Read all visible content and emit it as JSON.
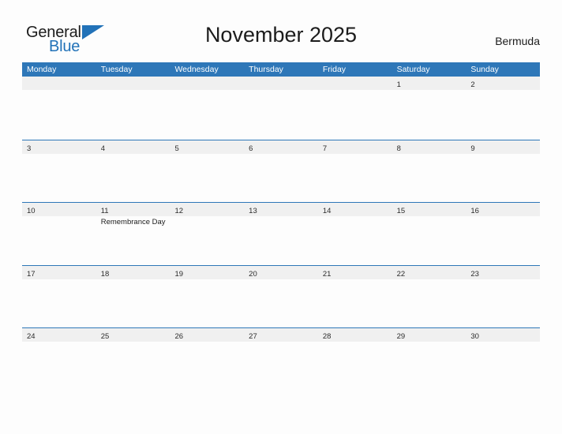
{
  "brand": {
    "name_part1": "General",
    "name_part2": "Blue",
    "triangle_icon": "brand-triangle-icon",
    "color_primary": "#2272b8"
  },
  "header": {
    "title": "November 2025",
    "country": "Bermuda"
  },
  "colors": {
    "header_blue": "#2e77b8",
    "date_band_gray": "#f0f0f0",
    "page_background": "#fdfdfd",
    "text_dark": "#1c1c1c"
  },
  "calendar": {
    "month": "November",
    "year": "2025",
    "weekday_headers": [
      "Monday",
      "Tuesday",
      "Wednesday",
      "Thursday",
      "Friday",
      "Saturday",
      "Sunday"
    ],
    "weeks": [
      {
        "days": [
          {
            "num": "",
            "events": []
          },
          {
            "num": "",
            "events": []
          },
          {
            "num": "",
            "events": []
          },
          {
            "num": "",
            "events": []
          },
          {
            "num": "",
            "events": []
          },
          {
            "num": "1",
            "events": []
          },
          {
            "num": "2",
            "events": []
          }
        ]
      },
      {
        "days": [
          {
            "num": "3",
            "events": []
          },
          {
            "num": "4",
            "events": []
          },
          {
            "num": "5",
            "events": []
          },
          {
            "num": "6",
            "events": []
          },
          {
            "num": "7",
            "events": []
          },
          {
            "num": "8",
            "events": []
          },
          {
            "num": "9",
            "events": []
          }
        ]
      },
      {
        "days": [
          {
            "num": "10",
            "events": []
          },
          {
            "num": "11",
            "events": [
              "Remembrance Day"
            ]
          },
          {
            "num": "12",
            "events": []
          },
          {
            "num": "13",
            "events": []
          },
          {
            "num": "14",
            "events": []
          },
          {
            "num": "15",
            "events": []
          },
          {
            "num": "16",
            "events": []
          }
        ]
      },
      {
        "days": [
          {
            "num": "17",
            "events": []
          },
          {
            "num": "18",
            "events": []
          },
          {
            "num": "19",
            "events": []
          },
          {
            "num": "20",
            "events": []
          },
          {
            "num": "21",
            "events": []
          },
          {
            "num": "22",
            "events": []
          },
          {
            "num": "23",
            "events": []
          }
        ]
      },
      {
        "days": [
          {
            "num": "24",
            "events": []
          },
          {
            "num": "25",
            "events": []
          },
          {
            "num": "26",
            "events": []
          },
          {
            "num": "27",
            "events": []
          },
          {
            "num": "28",
            "events": []
          },
          {
            "num": "29",
            "events": []
          },
          {
            "num": "30",
            "events": []
          }
        ]
      }
    ]
  }
}
